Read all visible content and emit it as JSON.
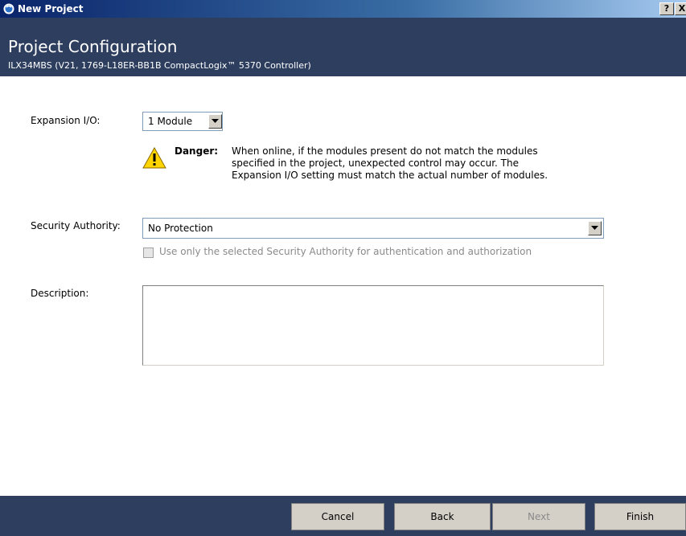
{
  "window": {
    "title": "New Project",
    "help_label": "?",
    "close_label": "X"
  },
  "header": {
    "title": "Project Configuration",
    "subtitle": "ILX34MBS (V21, 1769-L18ER-BB1B CompactLogix™ 5370 Controller)"
  },
  "expansion": {
    "label": "Expansion I/O:",
    "value": "1 Module"
  },
  "danger": {
    "label": "Danger:",
    "lines": [
      "When online, if the modules present do not match the modules",
      "specified in the project, unexpected control may occur.  The",
      "Expansion I/O setting must match the actual number of modules."
    ]
  },
  "security": {
    "label": "Security Authority:",
    "value": "No Protection",
    "checkbox_label": "Use only the selected Security Authority for authentication and authorization",
    "checkbox_checked": false
  },
  "description": {
    "label": "Description:",
    "value": ""
  },
  "footer": {
    "cancel": "Cancel",
    "back": "Back",
    "next": "Next",
    "finish": "Finish"
  }
}
